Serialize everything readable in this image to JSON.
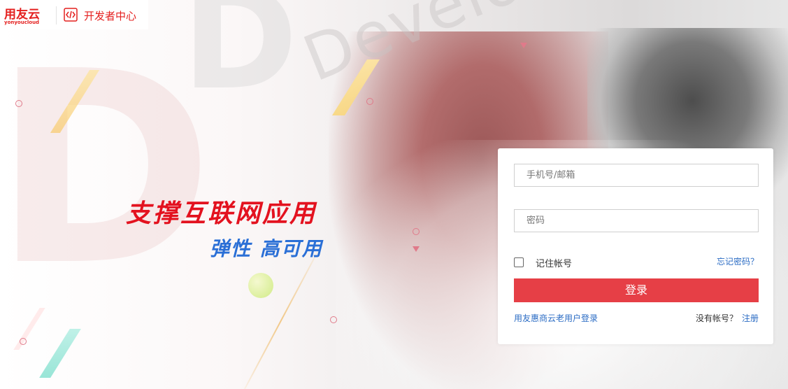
{
  "header": {
    "logo_cn": "用友云",
    "logo_en": "yonyoucloud",
    "title": "开发者中心",
    "brand_color": "#e4201f"
  },
  "background": {
    "watermark_text": "Develo"
  },
  "slogan": {
    "line1": "支撑互联网应用",
    "line2": "弹性 高可用",
    "line1_color": "#e3121f",
    "line2_color": "#2a6fd6"
  },
  "login": {
    "username_placeholder": "手机号/邮箱",
    "password_placeholder": "密码",
    "remember_label": "记住帐号",
    "remember_checked": false,
    "forgot_label": "忘记密码？",
    "login_button": "登录",
    "old_user_link": "用友惠商云老用户登录",
    "no_account_text": "没有帐号？",
    "register_link": "注册",
    "button_color": "#e63f46",
    "link_color": "#2b6cc4"
  }
}
